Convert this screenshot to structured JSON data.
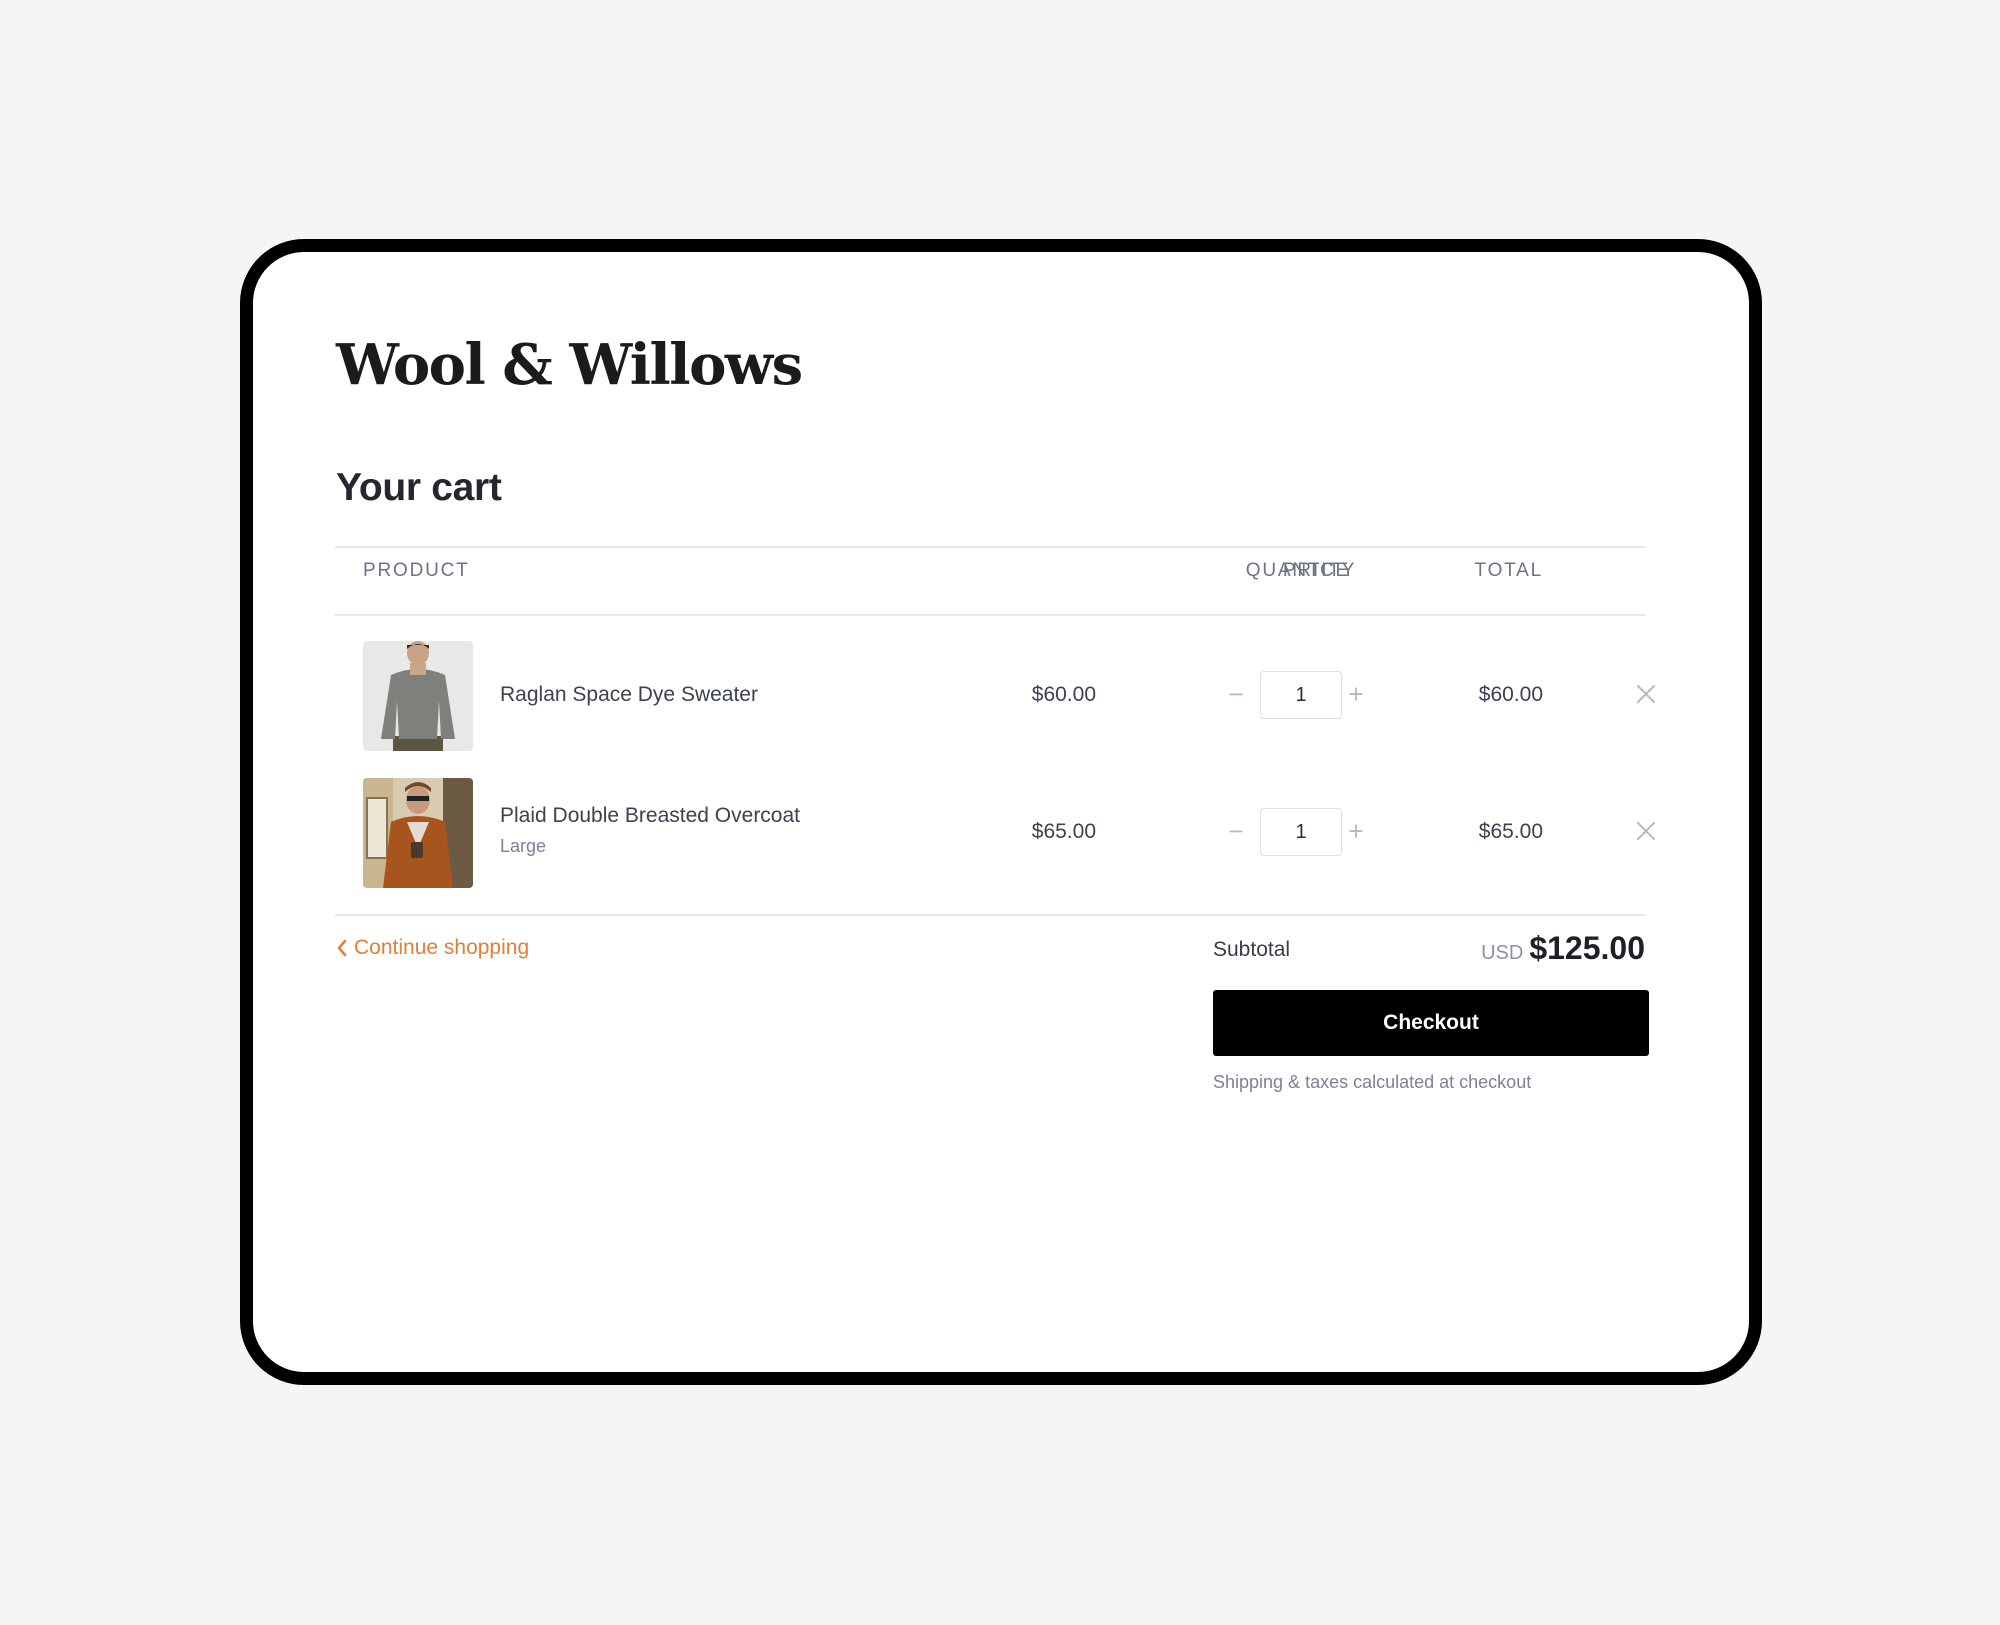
{
  "brand": {
    "name": "Wool & Willows"
  },
  "page": {
    "title": "Your cart"
  },
  "table": {
    "headers": {
      "product": "PRODUCT",
      "price": "PRICE",
      "quantity": "QUANTITY",
      "total": "TOTAL"
    }
  },
  "items": [
    {
      "name": "Raglan Space Dye Sweater",
      "variant": "",
      "price": "$60.00",
      "quantity": "1",
      "total": "$60.00",
      "image": "grey-sweater-photo"
    },
    {
      "name": "Plaid Double Breasted Overcoat",
      "variant": "Large",
      "price": "$65.00",
      "quantity": "1",
      "total": "$65.00",
      "image": "brown-overcoat-photo"
    }
  ],
  "footer": {
    "continue_label": "Continue shopping",
    "subtotal_label": "Subtotal",
    "currency": "USD",
    "subtotal_amount": "$125.00",
    "checkout_label": "Checkout",
    "shipping_note": "Shipping & taxes calculated at checkout"
  },
  "icons": {
    "continue": "chevron-left-icon",
    "decrease": "minus-icon",
    "increase": "plus-icon",
    "remove": "close-icon"
  },
  "colors": {
    "accent": "#e07f39",
    "checkout_bg": "#000000",
    "background": "#f5f5f5"
  }
}
